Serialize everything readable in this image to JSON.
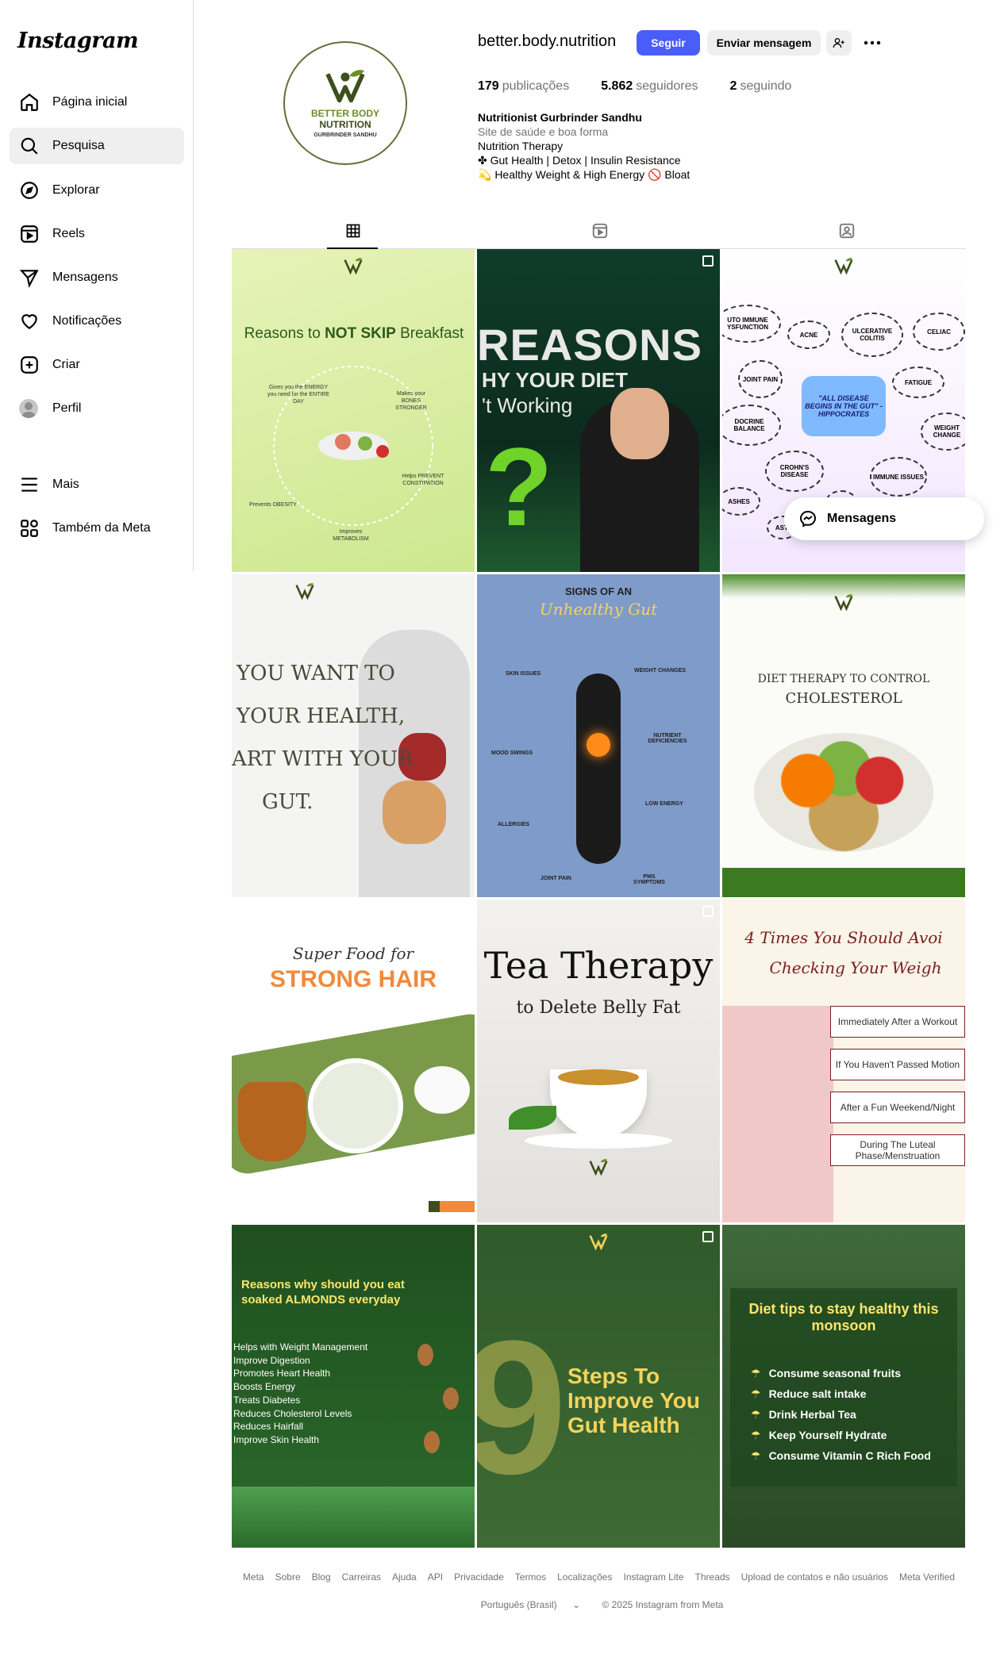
{
  "sidebar": {
    "logo": "Instagram",
    "items": [
      {
        "label": "Página inicial",
        "icon": "home-icon"
      },
      {
        "label": "Pesquisa",
        "icon": "search-icon"
      },
      {
        "label": "Explorar",
        "icon": "compass-icon"
      },
      {
        "label": "Reels",
        "icon": "reels-icon"
      },
      {
        "label": "Mensagens",
        "icon": "send-icon"
      },
      {
        "label": "Notificações",
        "icon": "heart-icon"
      },
      {
        "label": "Criar",
        "icon": "plus-square-icon"
      },
      {
        "label": "Perfil",
        "icon": "avatar-icon"
      },
      {
        "label": "Mais",
        "icon": "menu-icon"
      },
      {
        "label": "Também da Meta",
        "icon": "meta-apps-icon"
      }
    ],
    "active_index": 1
  },
  "profile": {
    "username": "better.body.nutrition",
    "follow_label": "Seguir",
    "message_label": "Enviar mensagem",
    "logo_line1": "BETTER BODY",
    "logo_line2": "NUTRITION",
    "logo_line3": "GURBRINDER SANDHU",
    "stats": [
      {
        "value": "179",
        "label": "publicações"
      },
      {
        "value": "5.862",
        "label": "seguidores"
      },
      {
        "value": "2",
        "label": "seguindo"
      }
    ],
    "bio": {
      "name": "Nutritionist Gurbrinder Sandhu",
      "category": "Site de saúde e boa forma",
      "line1": "Nutrition Therapy",
      "line2": "✤ Gut Health | Detox | Insulin Resistance",
      "line3": "💫 Healthy Weight & High Energy 🚫 Bloat"
    }
  },
  "tabs": [
    {
      "icon": "grid-icon",
      "active": true
    },
    {
      "icon": "reels-tab-icon",
      "active": false
    },
    {
      "icon": "tagged-icon",
      "active": false
    }
  ],
  "posts": {
    "p1": {
      "title_a": "Reasons to ",
      "title_b": "NOT SKIP",
      "title_c": " Breakfast",
      "l1": "Gives you the ENERGY you need for the ENTIRE DAY",
      "l2": "Makes your BONES STRONGER",
      "l3": "Helps PREVENT CONSTIPATION",
      "l4": "Improves METABOLISM",
      "l5": "Prevents OBESITY"
    },
    "p2": {
      "t1": "REASONS",
      "t2": "HY YOUR DIET",
      "t3": "'t Working"
    },
    "p3": {
      "center": "\"ALL DISEASE BEGINS IN THE GUT\" -HIPPOCRATES",
      "bubbles": [
        "UTO IMMUNE YSFUNCTION",
        "ACNE",
        "ULCERATIVE COLITIS",
        "CELIAC",
        "JOINT PAIN",
        "FATIGUE",
        "DOCRINE BALANCE",
        "WEIGHT CHANGE",
        "CROHN'S DISEASE",
        "IMMUNE ISSUES",
        "ASHES",
        "ASTI",
        "IBD"
      ]
    },
    "p4": {
      "t1": "YOU WANT TO",
      "t2": "YOUR HEALTH,",
      "t3": "ART WITH YOUR",
      "t4": "GUT."
    },
    "p5": {
      "t1": "SIGNS OF AN",
      "t2": "Unhealthy Gut",
      "labels": [
        "SKIN ISSUES",
        "WEIGHT CHANGES",
        "NUTRIENT DEFICIENCIES",
        "MOOD SWINGS",
        "LOW ENERGY",
        "ALLERGIES",
        "JOINT PAIN",
        "PMS SYMPTOMS"
      ]
    },
    "p6": {
      "t1": "DIET THERAPY TO CONTROL",
      "t2": "CHOLESTEROL"
    },
    "p7": {
      "t1": "Super Food for",
      "t2": "STRONG HAIR"
    },
    "p8": {
      "t1": "Tea Therapy",
      "t2": "to Delete Belly Fat"
    },
    "p9": {
      "t1": "4 Times You Should Avoi",
      "t2": "Checking Your Weigh",
      "items": [
        "Immediately After a Workout",
        "If You Haven't Passed Motion",
        "After a Fun Weekend/Night",
        "During The Luteal Phase/Menstruation"
      ]
    },
    "p10": {
      "title": "Reasons why should you eat soaked ALMONDS everyday",
      "items": [
        "Helps with Weight Management",
        "Improve Digestion",
        "Promotes Heart Health",
        "Boosts Energy",
        "Treats Diabetes",
        "Reduces Cholesterol Levels",
        "Reduces Hairfall",
        "Improve Skin Health"
      ]
    },
    "p11": {
      "num": "9",
      "t1": "Steps To",
      "t2": "Improve You",
      "t3": "Gut Health"
    },
    "p12": {
      "title": "Diet tips to stay healthy this monsoon",
      "items": [
        "Consume seasonal fruits",
        "Reduce salt intake",
        "Drink Herbal Tea",
        "Keep Yourself Hydrate",
        "Consume Vitamin C Rich Food"
      ]
    }
  },
  "floating": {
    "label": "Mensagens"
  },
  "footer": {
    "links": [
      "Meta",
      "Sobre",
      "Blog",
      "Carreiras",
      "Ajuda",
      "API",
      "Privacidade",
      "Termos",
      "Localizações",
      "Instagram Lite",
      "Threads",
      "Upload de contatos e não usuários",
      "Meta Verified"
    ],
    "language": "Português (Brasil)",
    "copyright": "© 2025 Instagram from Meta"
  },
  "colors": {
    "accent": "#4a5df9",
    "brand_green": "#6b8e23"
  }
}
